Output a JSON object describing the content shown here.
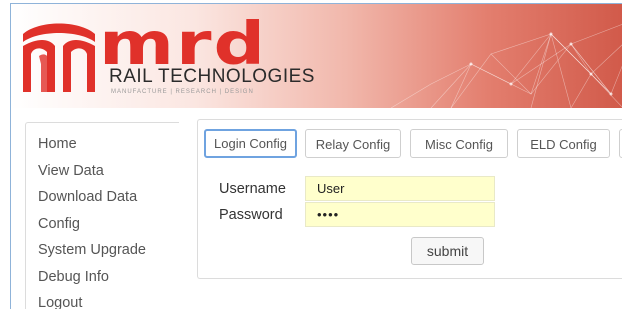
{
  "brand": {
    "name": "mrd",
    "subtitle": "RAIL TECHNOLOGIES",
    "tagline": "MANUFACTURE | RESEARCH | DESIGN"
  },
  "sidebar": {
    "items": [
      {
        "label": "Home"
      },
      {
        "label": "View Data"
      },
      {
        "label": "Download Data"
      },
      {
        "label": "Config"
      },
      {
        "label": "System Upgrade"
      },
      {
        "label": "Debug Info"
      },
      {
        "label": "Logout"
      }
    ]
  },
  "tabs": [
    {
      "label": "Login Config",
      "active": true
    },
    {
      "label": "Relay Config",
      "active": false
    },
    {
      "label": "Misc Config",
      "active": false
    },
    {
      "label": "ELD Config",
      "active": false
    }
  ],
  "form": {
    "username_label": "Username",
    "username_value": "User",
    "password_label": "Password",
    "password_value": "••••",
    "submit_label": "submit"
  },
  "colors": {
    "brand_red": "#e0312a",
    "field_bg": "#ffffcc",
    "active_tab_border": "#6fa3e0"
  }
}
